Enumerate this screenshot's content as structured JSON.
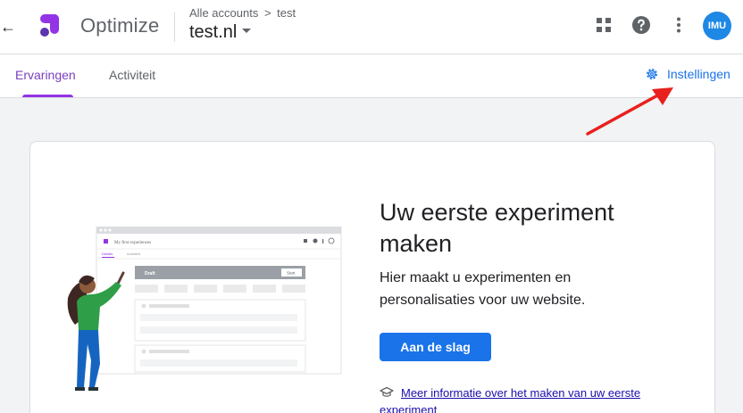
{
  "header": {
    "app_name": "Optimize",
    "breadcrumb": {
      "accounts": "Alle accounts",
      "separator": ">",
      "container": "test"
    },
    "property": "test.nl",
    "avatar_text": "IMU"
  },
  "tabs": [
    {
      "label": "Ervaringen",
      "active": true
    },
    {
      "label": "Activiteit",
      "active": false
    }
  ],
  "settings_label": "Instellingen",
  "card": {
    "title": "Uw eerste experiment maken",
    "description": "Hier maakt u experimenten en personalisaties voor uw website.",
    "button_label": "Aan de slag",
    "link_text": "Meer informatie over het maken van uw eerste experiment"
  },
  "illustration": {
    "window_title": "My first experiences",
    "tab1": "Details",
    "tab2": "Activiteit",
    "list_title": "Draft",
    "list_button": "Start"
  },
  "colors": {
    "accent": "#1a73e8",
    "tab_active": "#9334e6",
    "arrow": "#e8211e"
  }
}
